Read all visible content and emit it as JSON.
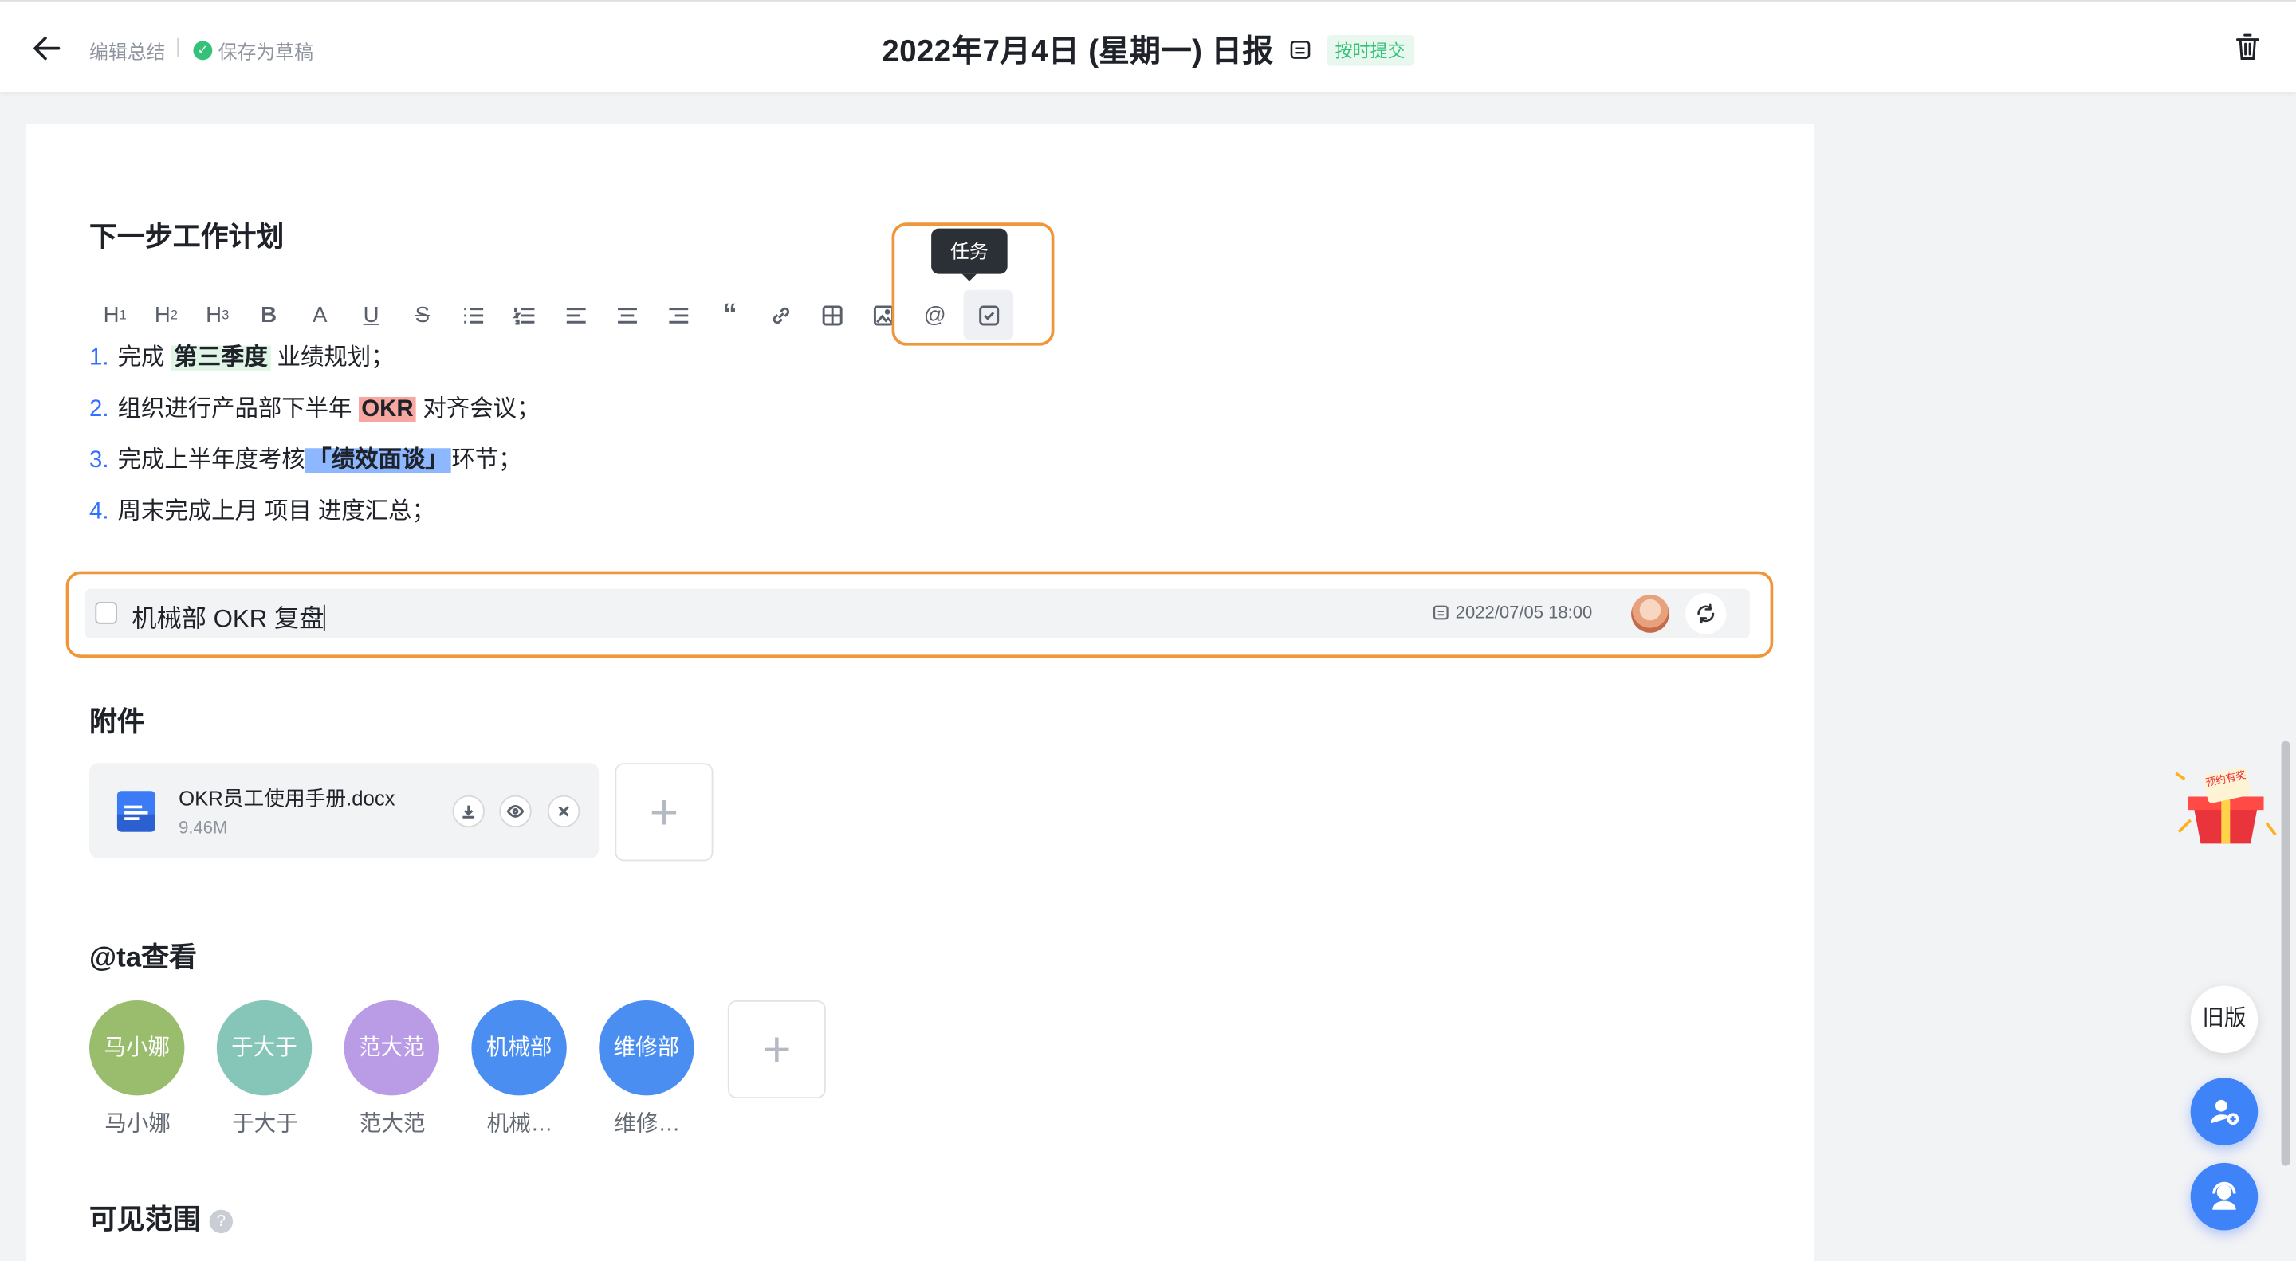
{
  "header": {
    "crumb": "编辑总结",
    "saved": "保存为草稿",
    "title": "2022年7月4日 (星期一) 日报",
    "status": "按时提交"
  },
  "plan": {
    "heading": "下一步工作计划",
    "tooltip": "任务",
    "items": [
      {
        "num": "1.",
        "pre": "完成 ",
        "mark": "第三季度",
        "post": " 业绩规划；"
      },
      {
        "num": "2.",
        "pre": "组织进行产品部下半年 ",
        "mark": "OKR",
        "post": " 对齐会议；"
      },
      {
        "num": "3.",
        "pre": "完成上半年度考核",
        "mark": "「绩效面谈」",
        "post": "环节；"
      },
      {
        "num": "4.",
        "pre": "周末完成上月 项目 进度汇总；",
        "mark": "",
        "post": ""
      }
    ],
    "task": {
      "text": "机械部 OKR 复盘",
      "due": "2022/07/05 18:00"
    }
  },
  "attachments": {
    "heading": "附件",
    "file": {
      "name": "OKR员工使用手册.docx",
      "size": "9.46M"
    }
  },
  "mentions": {
    "heading": "@ta查看",
    "people": [
      {
        "avatar": "马小娜",
        "name": "马小娜",
        "color": "#99bd6c"
      },
      {
        "avatar": "于大于",
        "name": "于大于",
        "color": "#86c6b8"
      },
      {
        "avatar": "范大范",
        "name": "范大范",
        "color": "#b99be6"
      },
      {
        "avatar": "机械部",
        "name": "机械…",
        "color": "#4a8ef2"
      },
      {
        "avatar": "维修部",
        "name": "维修…",
        "color": "#4a8ef2"
      }
    ]
  },
  "visibility": {
    "heading": "可见范围",
    "help": "?"
  },
  "side": {
    "old_version": "旧版",
    "promo": "预约有奖"
  },
  "colors": {
    "accent": "#3370ff",
    "highlight_border": "#f0963a",
    "success": "#34c27a"
  },
  "icons": [
    "back-arrow-icon",
    "calendar-icon",
    "trash-icon",
    "task-check-icon",
    "word-doc-icon",
    "download-icon",
    "eye-icon",
    "close-icon",
    "plus-icon",
    "refresh-icon",
    "user-add-icon",
    "support-icon",
    "gift-icon"
  ]
}
